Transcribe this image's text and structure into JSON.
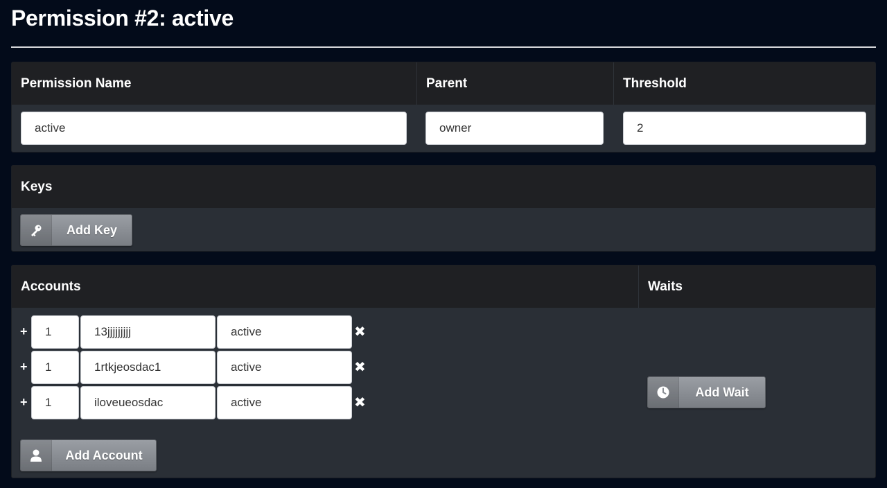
{
  "page": {
    "title": "Permission #2: active"
  },
  "permission": {
    "headers": {
      "name": "Permission Name",
      "parent": "Parent",
      "threshold": "Threshold"
    },
    "values": {
      "name": "active",
      "parent": "owner",
      "threshold": "2"
    }
  },
  "keys": {
    "header": "Keys",
    "add_button": "Add Key",
    "add_icon": "key-icon"
  },
  "accounts": {
    "header": "Accounts",
    "rows": [
      {
        "plus": "+",
        "weight": "1",
        "actor": "13jjjjjjjjj",
        "permission": "active"
      },
      {
        "plus": "+",
        "weight": "1",
        "actor": "1rtkjeosdac1",
        "permission": "active"
      },
      {
        "plus": "+",
        "weight": "1",
        "actor": "iloveueosdac",
        "permission": "active"
      }
    ],
    "remove_glyph": "✖",
    "add_button": "Add Account",
    "add_icon": "user-icon"
  },
  "waits": {
    "header": "Waits",
    "add_button": "Add Wait",
    "add_icon": "clock-icon"
  },
  "colors": {
    "background": "#030b1a",
    "panel": "#2a2f36",
    "panel_header": "#1f2023",
    "button": "#8a8e94"
  }
}
